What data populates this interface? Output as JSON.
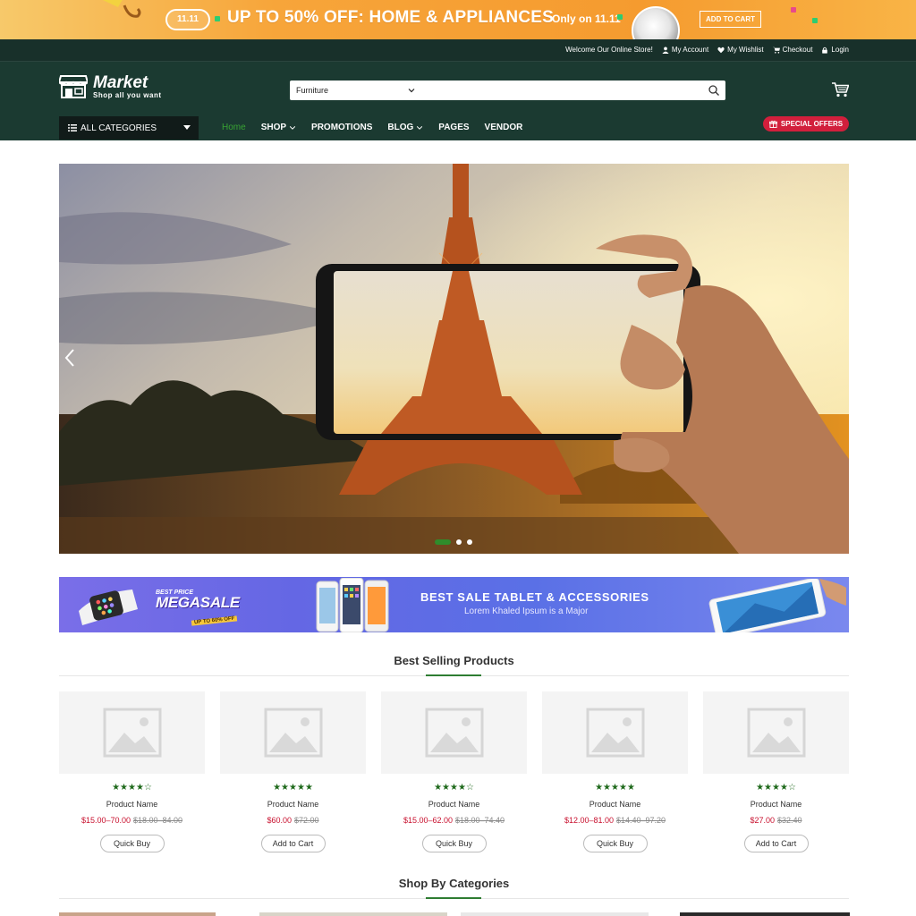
{
  "promo": {
    "badge": "11.11",
    "headline": "UP TO 50% OFF: HOME & APPLIANCES",
    "only_on": "Only on 11.11",
    "add_to_cart": "ADD TO CART"
  },
  "topbar": {
    "welcome": "Welcome Our Online Store!",
    "links": [
      "My Account",
      "My Wishlist",
      "Checkout",
      "Login"
    ]
  },
  "logo": {
    "name": "Market",
    "tagline": "Shop all you want"
  },
  "search": {
    "category": "Furniture",
    "placeholder": ""
  },
  "nav": {
    "all_categories": "ALL CATEGORIES",
    "items": [
      "Home",
      "SHOP",
      "PROMOTIONS",
      "BLOG",
      "PAGES",
      "VENDOR"
    ],
    "special_offers": "SPECIAL OFFERS"
  },
  "hero": {
    "slide_count": 3,
    "active_slide": 1
  },
  "mid_banner": {
    "best_price": "BEST PRICE",
    "megasale": "MEGASALE",
    "up_to": "UP TO 60% OFF",
    "title": "BEST SALE TABLET &  ACCESSORIES",
    "subtitle": "Lorem Khaled Ipsum is a Major"
  },
  "best_selling": {
    "title": "Best Selling Products",
    "products": [
      {
        "stars": "★★★★☆",
        "name": "Product Name",
        "price": "$15.00–70.00",
        "old_price": "$18.00–84.00",
        "button": "Quick Buy"
      },
      {
        "stars": "★★★★★",
        "name": "Product Name",
        "price": "$60.00",
        "old_price": "$72.00",
        "button": "Add to Cart"
      },
      {
        "stars": "★★★★☆",
        "name": "Product Name",
        "price": "$15.00–62.00",
        "old_price": "$18.00–74.40",
        "button": "Quick Buy"
      },
      {
        "stars": "★★★★★",
        "name": "Product Name",
        "price": "$12.00–81.00",
        "old_price": "$14.40–97.20",
        "button": "Quick Buy"
      },
      {
        "stars": "★★★★☆",
        "name": "Product Name",
        "price": "$27.00",
        "old_price": "$32.40",
        "button": "Add to Cart"
      }
    ]
  },
  "shop_by_categories": {
    "title": "Shop By Categories"
  },
  "colors": {
    "header_bg": "#1b3a31",
    "topbar_bg": "#18302a",
    "accent_green": "#2e7d32",
    "special_red": "#d21f3c",
    "price_red": "#c8102e",
    "promo_orange": "#f59b2f"
  }
}
